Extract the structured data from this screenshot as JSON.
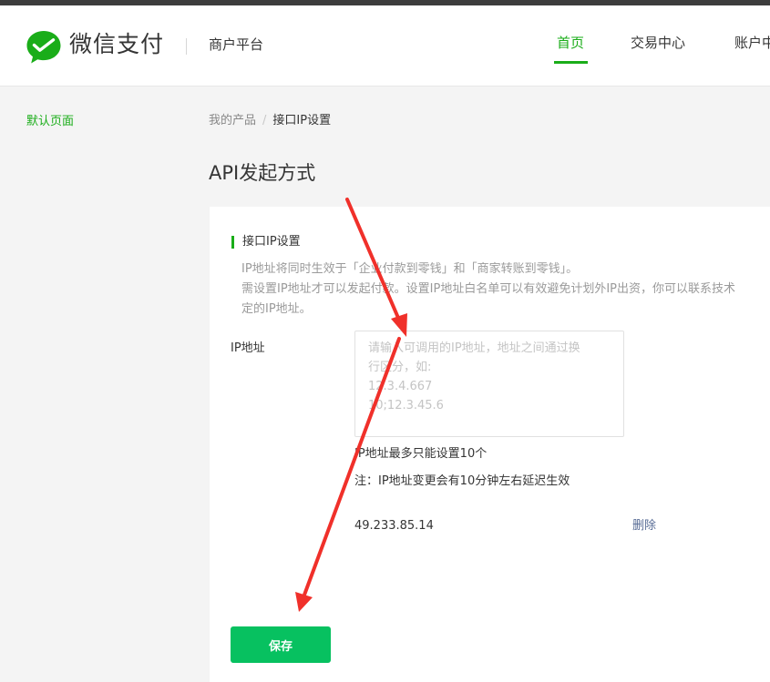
{
  "brand": {
    "name": "微信支付",
    "subtitle": "商户平台",
    "logo_icon": "wechat-pay-logo-icon",
    "accent_color": "#1aad19"
  },
  "nav": {
    "items": [
      {
        "label": "首页",
        "active": true
      },
      {
        "label": "交易中心",
        "active": false
      },
      {
        "label": "账户中",
        "active": false
      }
    ]
  },
  "sidebar": {
    "items": [
      {
        "label": "默认页面",
        "active": true
      }
    ]
  },
  "breadcrumb": {
    "items": [
      "我的产品",
      "接口IP设置"
    ],
    "separator": "/"
  },
  "page": {
    "title": "API发起方式"
  },
  "section": {
    "title": "接口IP设置",
    "description_lines": [
      "IP地址将同时生效于「企业付款到零钱」和「商家转账到零钱」。",
      "需设置IP地址才可以发起付款。设置IP地址白名单可以有效避免计划外IP出资，你可以联系技术",
      "定的IP地址。"
    ]
  },
  "form": {
    "ip_label": "IP地址",
    "ip_input_value": "",
    "ip_placeholder": "请输入可调用的IP地址，地址之间通过换\n行区分，如:\n12.3.4.667\n10;12.3.45.6",
    "hint_max": "IP地址最多只能设置10个",
    "hint_delay": "注：IP地址变更会有10分钟左右延迟生效",
    "ip_list": [
      {
        "ip": "49.233.85.14",
        "action": "删除"
      }
    ],
    "save_label": "保存"
  },
  "colors": {
    "save_button": "#07c160",
    "link": "#576b95",
    "annotation_arrow": "#f0302a"
  }
}
